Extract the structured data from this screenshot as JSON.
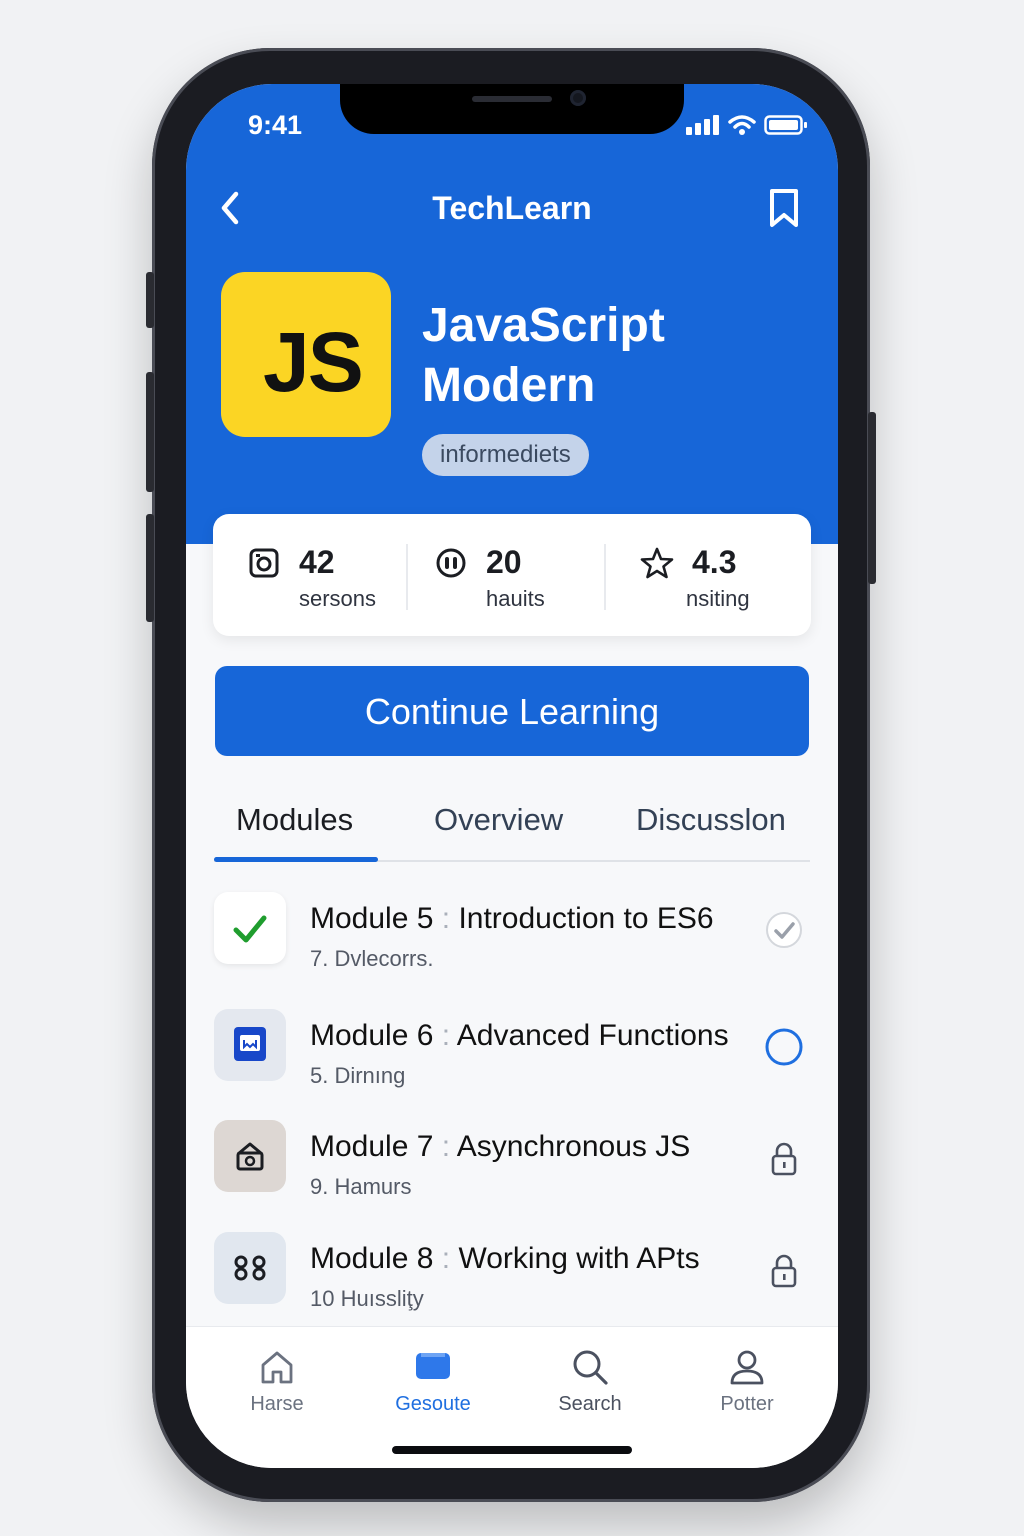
{
  "status_bar": {
    "time": "9:41",
    "icons": [
      "signal-icon",
      "wifi-icon",
      "battery-icon"
    ]
  },
  "nav": {
    "title": "TechLearn",
    "back_icon": "chevron-left-icon",
    "bookmark_icon": "bookmark-icon"
  },
  "course": {
    "logo_text": "JS",
    "title_line1": "JavaScript",
    "title_line2": "Modern",
    "level": "informediets"
  },
  "stats": [
    {
      "icon": "lessons-icon",
      "value": "42",
      "label": "sersons"
    },
    {
      "icon": "hours-icon",
      "value": "20",
      "label": "hauits"
    },
    {
      "icon": "star-icon",
      "value": "4.3",
      "label": "nsiting"
    }
  ],
  "cta": {
    "label": "Continue Learning"
  },
  "tabs": [
    {
      "label": "Modules",
      "active": true
    },
    {
      "label": "Overview",
      "active": false
    },
    {
      "label": "Discusslon",
      "active": false
    }
  ],
  "modules": [
    {
      "number": "Module 5",
      "title": "Introduction to ES6",
      "sub": "7. Dvlecorrs.",
      "status": "completed",
      "thumb_icon": "checkmark-icon"
    },
    {
      "number": "Module 6",
      "title": "Advanced Functions",
      "sub": "5. Dirnıng",
      "status": "in-progress",
      "thumb_icon": "book-icon"
    },
    {
      "number": "Module 7",
      "title": "Asynchronous JS",
      "sub": "9. Hamurs",
      "status": "locked",
      "thumb_icon": "async-icon"
    },
    {
      "number": "Module 8",
      "title": "Working with APts",
      "sub": "10 Huıssliţy",
      "status": "locked",
      "thumb_icon": "api-icon"
    }
  ],
  "tabbar": [
    {
      "label": "Harse",
      "icon": "home-icon",
      "active": false
    },
    {
      "label": "Gesoute",
      "icon": "courses-icon",
      "active": true
    },
    {
      "label": "Search",
      "icon": "search-icon",
      "active": false
    },
    {
      "label": "Potter",
      "icon": "profile-icon",
      "active": false
    }
  ],
  "colors": {
    "primary": "#1766d8",
    "logo": "#fbd524",
    "success": "#1f9d2e"
  }
}
